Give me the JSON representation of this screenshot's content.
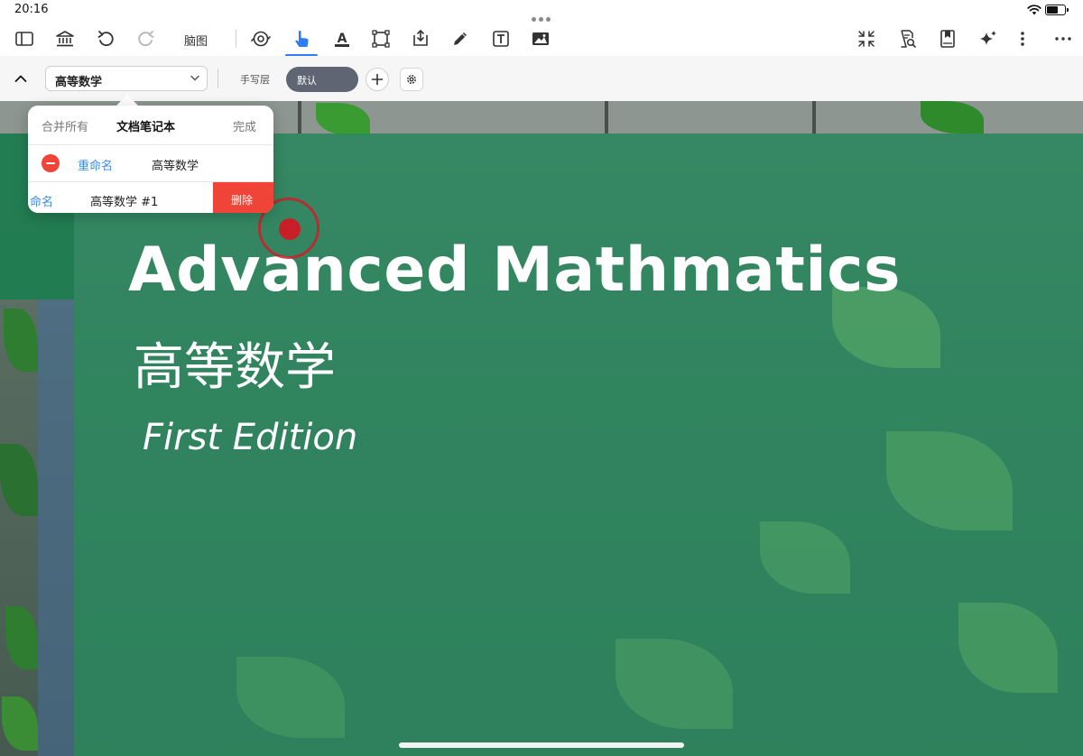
{
  "status_bar": {
    "time": "20:16"
  },
  "toolbar": {
    "mindmap_label": "脑图",
    "icons": [
      "sidebar-icon",
      "library-icon",
      "undo-icon",
      "redo-icon",
      "mindmap-label",
      "lasso-icon",
      "hand-pointer-icon",
      "highlighter-icon",
      "rectangle-select-icon",
      "insert-space-icon",
      "pen-icon",
      "text-box-icon",
      "image-icon",
      "collapse-icon",
      "document-search-icon",
      "bookmark-icon",
      "ai-sparkle-icon",
      "more-vertical-icon",
      "more-horizontal-icon"
    ],
    "active_tool": "hand-pointer"
  },
  "layer_bar": {
    "notebook_value": "高等数学",
    "handwriting_layer_label": "手写层",
    "default_layer_label": "默认"
  },
  "popover": {
    "merge_all": "合并所有",
    "title": "文档笔记本",
    "done": "完成",
    "rows": [
      {
        "rename": "重命名",
        "name": "高等数学"
      },
      {
        "rename": "命名",
        "name": "高等数学 #1",
        "delete": "删除"
      }
    ]
  },
  "document": {
    "title": "Advanced Mathmatics",
    "subtitle_cn": "高等数学",
    "edition": "First Edition"
  },
  "colors": {
    "accent": "#2e7cf6",
    "delete_red": "#f04438",
    "cover_green": "#278c5f",
    "link_blue": "#3d8be8"
  }
}
